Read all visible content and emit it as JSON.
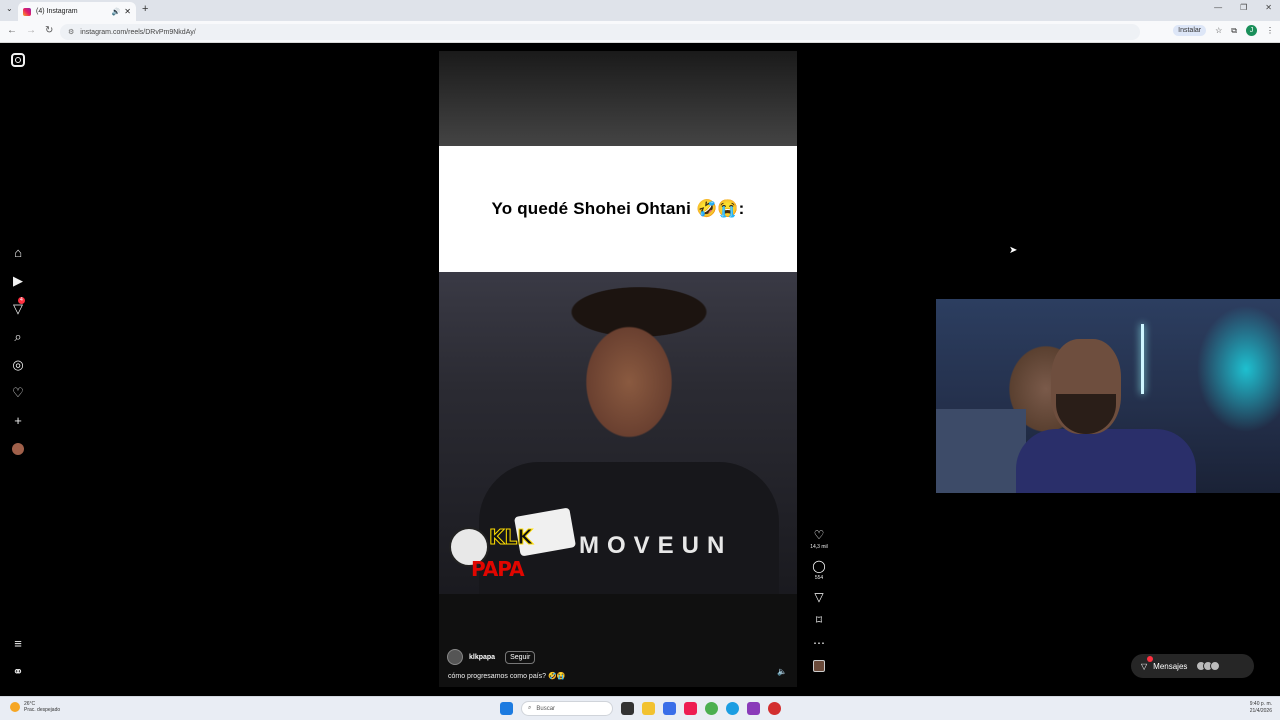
{
  "browser": {
    "tab_title": "(4) Instagram",
    "url": "instagram.com/reels/DRvPm9NkdAy/",
    "install_label": "Instalar",
    "profile_initial": "J"
  },
  "nav": {
    "notification_count": "4"
  },
  "reel": {
    "caption_card_text": "Yo quedé Shohei Ohtani 🤣😭:",
    "shirt_text": "MOVEUN",
    "logo_top": "KLK",
    "logo_bottom": "PAPA",
    "author": "klkpapa",
    "follow_label": "Seguir",
    "post_caption": "cómo progresamos como país? 🤣😭",
    "likes": "14,3 mil",
    "comments": "554"
  },
  "messages": {
    "label": "Mensajes"
  },
  "taskbar": {
    "temperature": "26°C",
    "weather": "Prac. despejado",
    "search_placeholder": "Buscar",
    "time": "9:40 p. m.",
    "date": "21/4/2026"
  },
  "colors": {
    "background": "#000000",
    "accent_red": "#ff3040",
    "taskbar": "#e9edf4"
  }
}
